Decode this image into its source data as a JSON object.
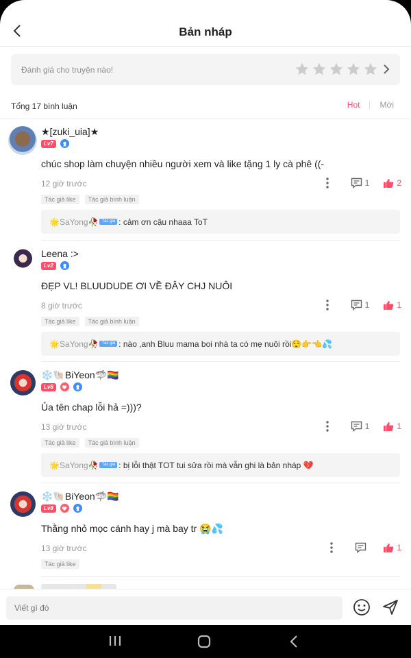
{
  "header": {
    "title": "Bản nháp"
  },
  "rating": {
    "prompt": "Đánh giá cho truyện nào!",
    "stars": 5,
    "star_color": "#cccccc"
  },
  "comments_meta": {
    "total_label": "Tổng 17 bình luận",
    "sort_hot": "Hot",
    "sort_new": "Mới"
  },
  "colors": {
    "accent": "#ff4d73",
    "level_badge": "#ff4d6a",
    "author_badge": "#5aa7ff"
  },
  "comments": [
    {
      "username": "★[zuki_uia]★",
      "level": "Lv7",
      "text": "chúc shop làm chuyện nhiều người xem và like tặng 1 ly cà phê ((-",
      "time": "12 giờ trước",
      "replies": "1",
      "likes": "2",
      "tags": [
        "Tác giả like",
        "Tác giả bình luận"
      ],
      "reply": {
        "name": "🌟SaYong🥀",
        "badge": "Tác giả",
        "text": ": cảm ơn cậu nhaaa ToT"
      }
    },
    {
      "username": "Leena :>",
      "level": "Lv2",
      "text": "ĐẸP VL! BLUUDUDE ƠI VỀ ĐÂY CHJ NUÔI",
      "time": "8 giờ trước",
      "replies": "1",
      "likes": "1",
      "tags": [
        "Tác giả like",
        "Tác giả bình luận"
      ],
      "reply": {
        "name": "🌟SaYong🥀",
        "badge": "Tác giả",
        "text": ": nào ,anh Bluu mama boi nhà ta có mẹ nuôi rồi😌👉👈💦"
      }
    },
    {
      "username": "❄️🐚BiYeon🦈🏳️‍🌈",
      "level": "Lv8",
      "text": "Ủa tên chap lỗi hả =)))?",
      "time": "13 giờ trước",
      "replies": "1",
      "likes": "1",
      "tags": [
        "Tác giả like",
        "Tác giả bình luận"
      ],
      "reply": {
        "name": "🌟SaYong🥀",
        "badge": "Tác giả",
        "text": ": bị lỗi thật TOT tui sửa rồi mà vẫn ghi là bản nháp 💔"
      }
    },
    {
      "username": "❄️🐚BiYeon🦈🏳️‍🌈",
      "level": "Lv8",
      "text": "Thằng nhỏ mọc cánh hay j mà bay tr 😭💦",
      "time": "13 giờ trước",
      "replies": "",
      "likes": "1",
      "tags": [
        "Tác giả like"
      ]
    }
  ],
  "composer": {
    "placeholder": "Viết gì đó"
  }
}
